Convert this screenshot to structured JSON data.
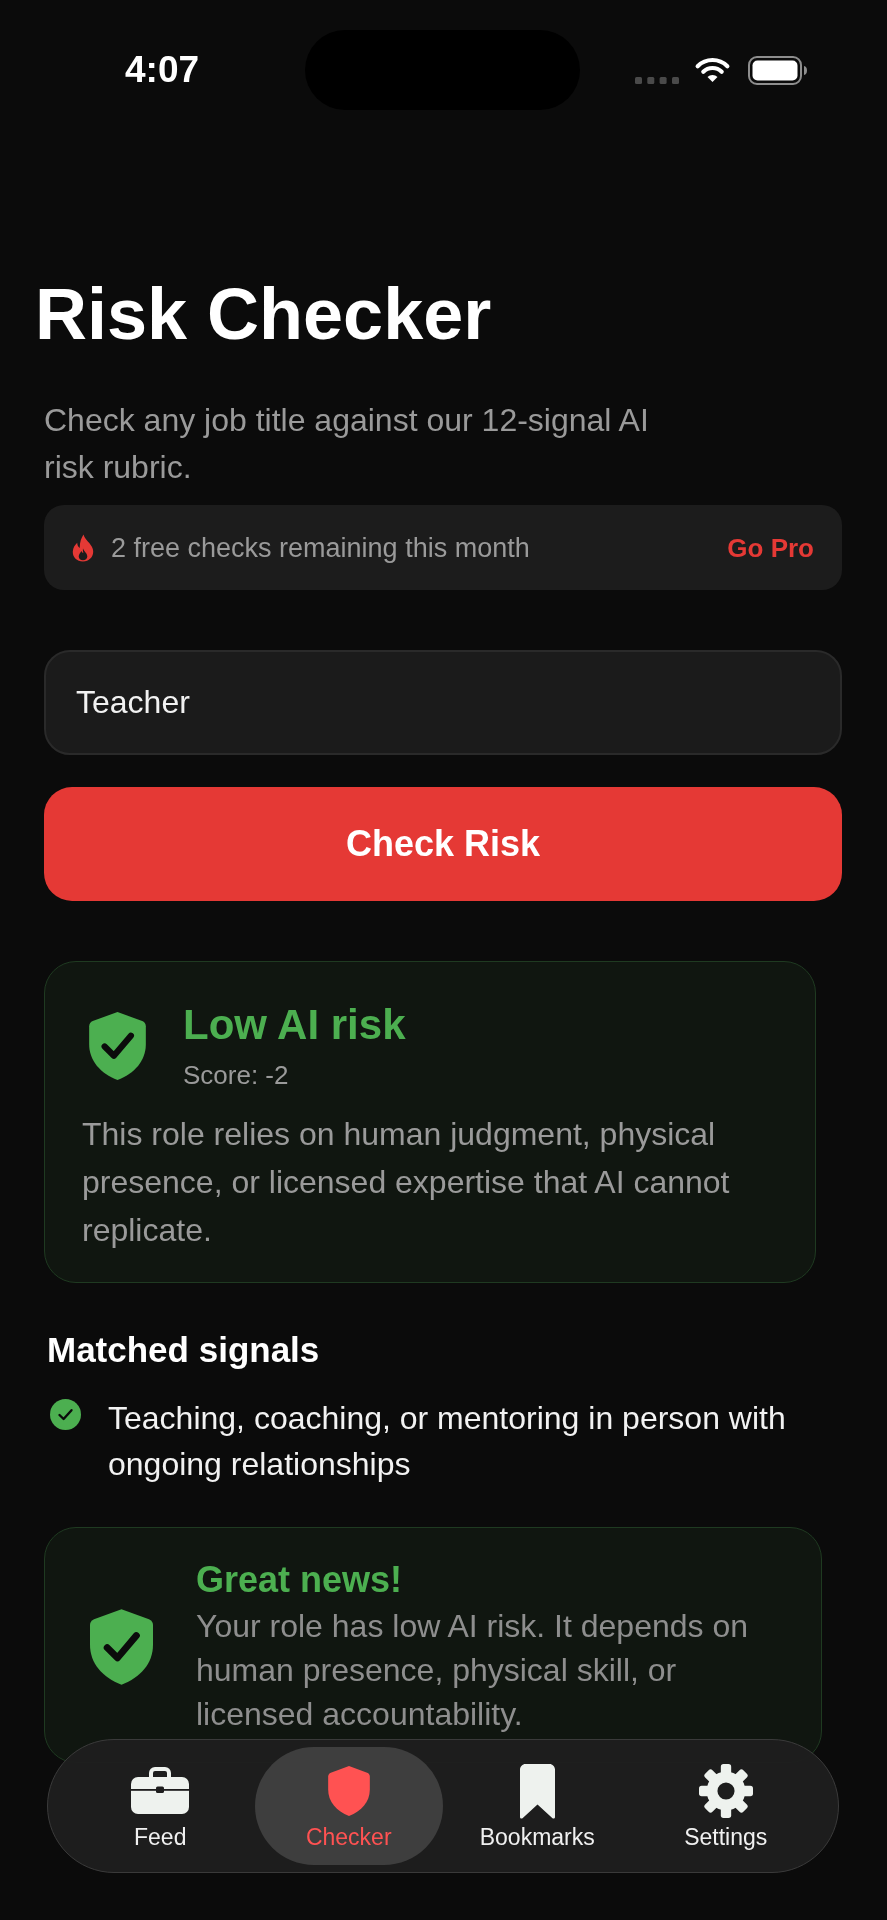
{
  "status_bar": {
    "time": "4:07"
  },
  "header": {
    "title": "Risk Checker",
    "subtitle": "Check any job title against our 12-signal AI risk rubric."
  },
  "quota_banner": {
    "text": "2 free checks remaining this month",
    "action": "Go Pro"
  },
  "job_field": {
    "value": "Teacher"
  },
  "check_button": {
    "label": "Check Risk"
  },
  "result": {
    "title": "Low AI risk",
    "score": "Score: -2",
    "description": "This role relies on human judgment, physical presence, or licensed expertise that AI cannot replicate."
  },
  "matched_signals": {
    "heading": "Matched signals",
    "items": [
      {
        "text": "Teaching, coaching, or mentoring in person with ongoing relationships"
      }
    ]
  },
  "verdict_card": {
    "title": "Great news!",
    "body": "Your role has low AI risk. It depends on human presence, physical skill, or licensed accountability."
  },
  "tab_bar": {
    "tabs": [
      {
        "label": "Feed",
        "selected": false
      },
      {
        "label": "Checker",
        "selected": true
      },
      {
        "label": "Bookmarks",
        "selected": false
      },
      {
        "label": "Settings",
        "selected": false
      }
    ]
  }
}
